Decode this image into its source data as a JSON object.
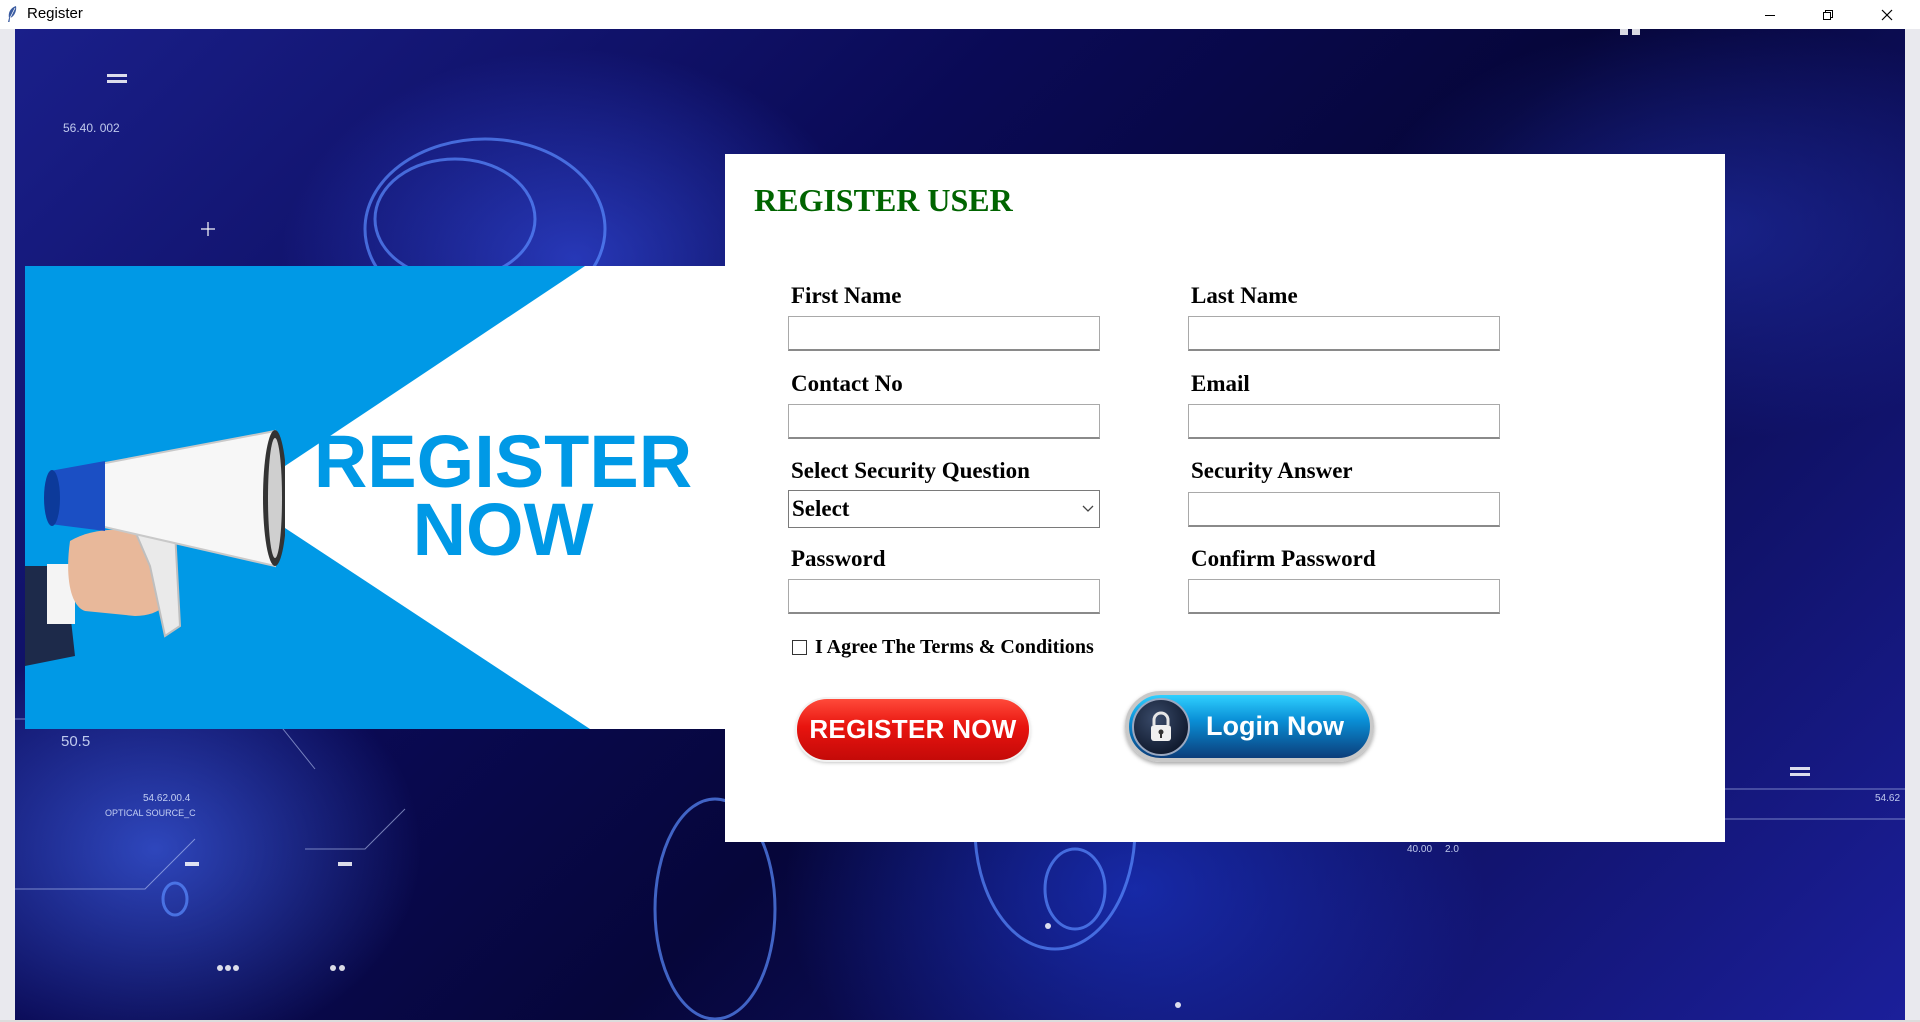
{
  "window": {
    "title": "Register",
    "icon": "feather-icon",
    "controls": [
      "minimize-icon",
      "restore-icon",
      "close-icon"
    ]
  },
  "background": {
    "readouts": [
      "56.40.  002",
      "50.5",
      "54.62.00.4",
      "OPTICAL SOURCE_C",
      "40.00",
      "2.0",
      "54.62"
    ]
  },
  "banner": {
    "line1": "REGISTER",
    "line2": "NOW",
    "icon": "megaphone-icon"
  },
  "form": {
    "title": "REGISTER USER",
    "first_name_label": "First Name",
    "first_name_value": "",
    "last_name_label": "Last Name",
    "last_name_value": "",
    "contact_label": "Contact No",
    "contact_value": "",
    "email_label": "Email",
    "email_value": "",
    "security_question_label": "Select Security Question",
    "security_question_value": "Select",
    "security_answer_label": "Security Answer",
    "security_answer_value": "",
    "password_label": "Password",
    "password_value": "",
    "confirm_password_label": "Confirm Password",
    "confirm_password_value": "",
    "terms_label": "I Agree The Terms & Conditions",
    "terms_checked": false,
    "register_button": "REGISTER NOW",
    "login_button": "Login Now"
  },
  "colors": {
    "title_green": "#006400",
    "banner_blue": "#0099e6",
    "register_red": "#e8140f",
    "login_blue": "#0a8fd6"
  }
}
